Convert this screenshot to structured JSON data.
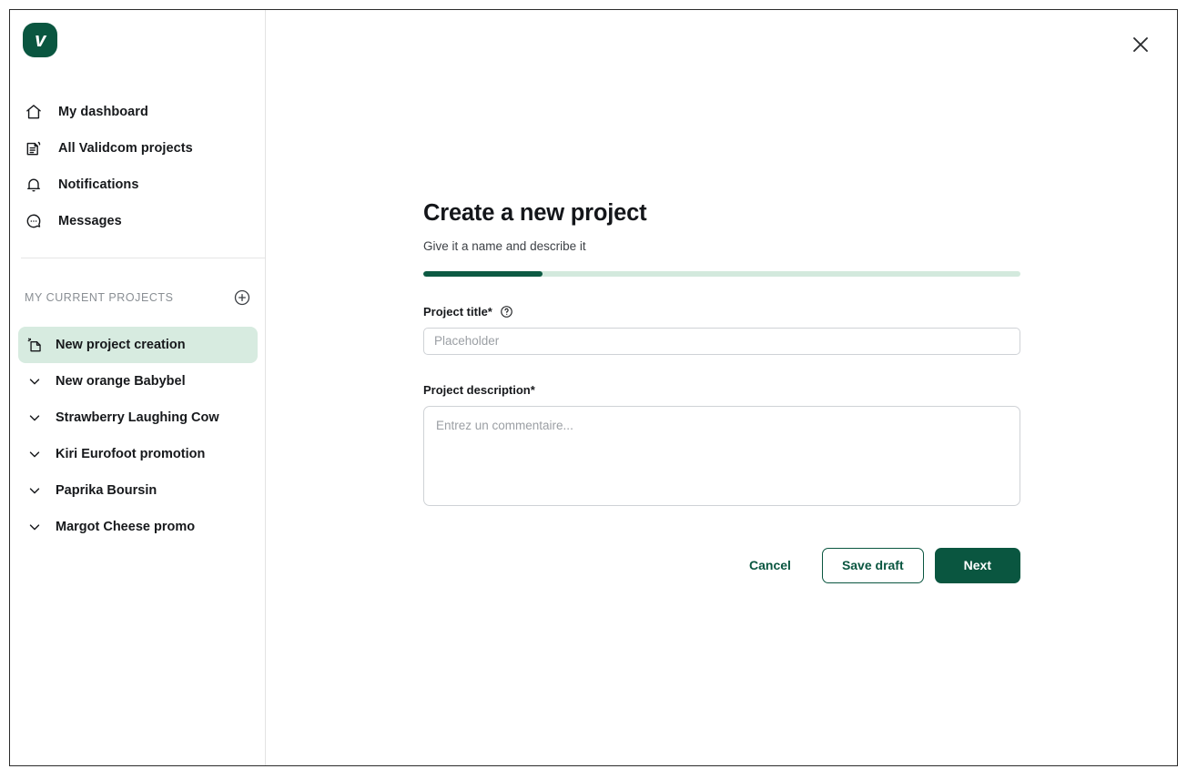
{
  "brand": {
    "logo_letter": "v",
    "logo_color": "#0a5640"
  },
  "sidebar": {
    "nav_items": [
      {
        "label": "My dashboard",
        "icon": "home-icon"
      },
      {
        "label": "All Validcom projects",
        "icon": "documents-icon"
      },
      {
        "label": "Notifications",
        "icon": "bell-icon"
      },
      {
        "label": "Messages",
        "icon": "chat-bubble-icon"
      }
    ],
    "projects_section": {
      "header": "MY CURRENT PROJECTS",
      "add_icon": "plus-circle-icon",
      "items": [
        {
          "label": "New project creation",
          "icon": "add-page-icon",
          "active": true
        },
        {
          "label": "New orange Babybel",
          "icon": "chevron-down-icon",
          "active": false
        },
        {
          "label": "Strawberry Laughing Cow",
          "icon": "chevron-down-icon",
          "active": false
        },
        {
          "label": "Kiri Eurofoot promotion",
          "icon": "chevron-down-icon",
          "active": false
        },
        {
          "label": "Paprika Boursin",
          "icon": "chevron-down-icon",
          "active": false
        },
        {
          "label": "Margot Cheese promo",
          "icon": "chevron-down-icon",
          "active": false
        }
      ],
      "active_background": "#d7ebe0"
    }
  },
  "main": {
    "close_icon": "close-icon",
    "title": "Create a new project",
    "subtitle": "Give it a name and describe it",
    "progress": {
      "percent": 20,
      "fill_color": "#0d5a43",
      "track_color": "#d3e9dd"
    },
    "fields": {
      "project_title": {
        "label": "Project title*",
        "help_icon": "question-circle-icon",
        "value": "",
        "placeholder": "Placeholder"
      },
      "project_description": {
        "label": "Project description*",
        "value": "",
        "placeholder": "Entrez un commentaire..."
      }
    },
    "actions": {
      "cancel_label": "Cancel",
      "save_draft_label": "Save draft",
      "next_label": "Next",
      "accent_color": "#0a5640"
    }
  }
}
